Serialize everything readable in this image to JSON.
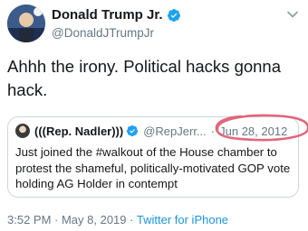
{
  "tweet": {
    "author": {
      "display_name": "Donald Trump Jr.",
      "handle": "@DonaldJTrumpJr",
      "verified": true
    },
    "text": "Ahhh the irony. Political hacks gonna hack.",
    "timestamp": "3:52 PM · May 8, 2019",
    "separator": "·",
    "source": "Twitter for iPhone"
  },
  "quoted_tweet": {
    "display_name": "(((Rep. Nadler)))",
    "handle": "@RepJerr...",
    "separator": "·",
    "date": "Jun 28, 2012",
    "verified": true,
    "text": "Just joined the #walkout of the House chamber to protest the shameful, politically-motivated GOP vote holding AG Holder in contempt"
  },
  "icons": {
    "menu": "chevron-down-icon",
    "verified": "verified-badge-icon"
  },
  "colors": {
    "verified_blue": "#1da1f2",
    "link_blue": "#1b95e0",
    "secondary_text": "#657786",
    "highlight_circle": "#e0556e"
  }
}
